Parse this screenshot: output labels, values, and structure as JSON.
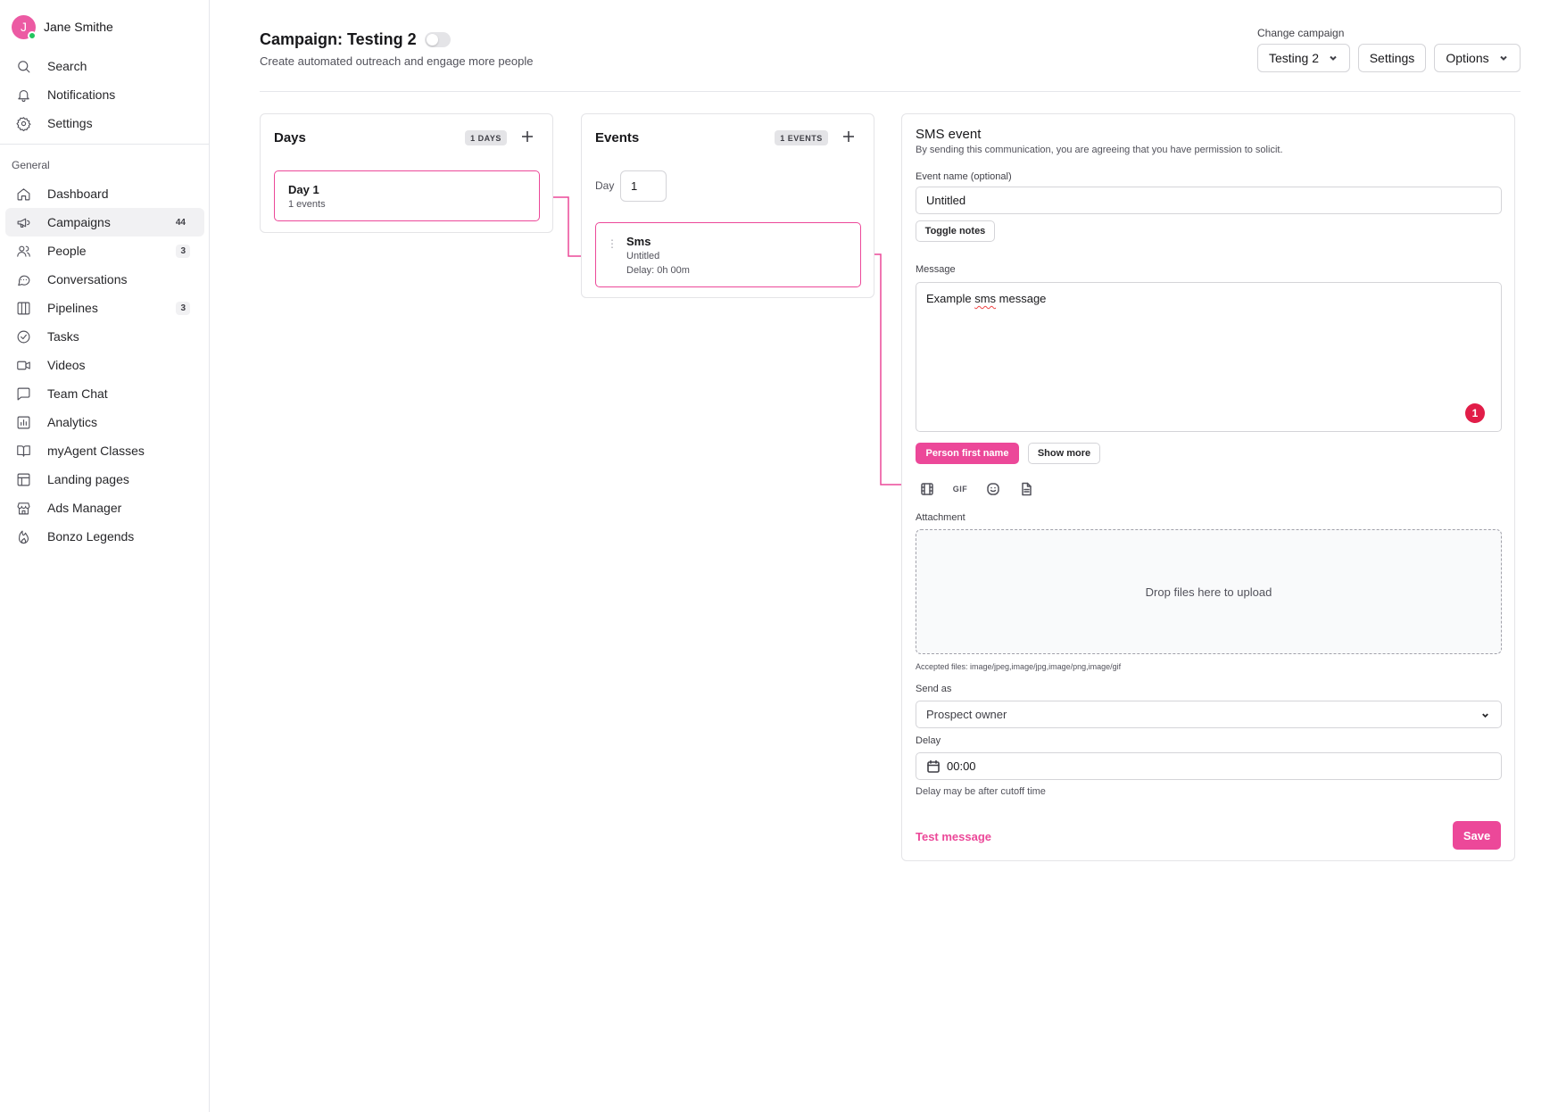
{
  "user": {
    "initial": "J",
    "name": "Jane Smithe"
  },
  "nav_top": [
    {
      "label": "Search",
      "icon": "search-icon"
    },
    {
      "label": "Notifications",
      "icon": "bell-icon"
    },
    {
      "label": "Settings",
      "icon": "gear-icon"
    }
  ],
  "section_title": "General",
  "nav_main": [
    {
      "label": "Dashboard",
      "icon": "home-icon",
      "count": ""
    },
    {
      "label": "Campaigns",
      "icon": "megaphone-icon",
      "count": "44",
      "active": true
    },
    {
      "label": "People",
      "icon": "users-icon",
      "count": "3"
    },
    {
      "label": "Conversations",
      "icon": "chat-bubble-icon",
      "count": ""
    },
    {
      "label": "Pipelines",
      "icon": "columns-icon",
      "count": "3"
    },
    {
      "label": "Tasks",
      "icon": "check-circle-icon",
      "count": ""
    },
    {
      "label": "Videos",
      "icon": "video-icon",
      "count": ""
    },
    {
      "label": "Team Chat",
      "icon": "message-square-icon",
      "count": ""
    },
    {
      "label": "Analytics",
      "icon": "bar-chart-icon",
      "count": ""
    },
    {
      "label": "myAgent Classes",
      "icon": "book-icon",
      "count": ""
    },
    {
      "label": "Landing pages",
      "icon": "layout-icon",
      "count": ""
    },
    {
      "label": "Ads Manager",
      "icon": "store-icon",
      "count": ""
    },
    {
      "label": "Bonzo Legends",
      "icon": "flame-icon",
      "count": ""
    }
  ],
  "header": {
    "title": "Campaign: Testing 2",
    "subtitle": "Create automated outreach and engage more people",
    "change_label": "Change campaign",
    "campaign_select": "Testing 2",
    "settings_label": "Settings",
    "options_label": "Options"
  },
  "days": {
    "title": "Days",
    "pill": "1 DAYS",
    "items": [
      {
        "title": "Day 1",
        "sub": "1 events"
      }
    ]
  },
  "events": {
    "title": "Events",
    "pill": "1 EVENTS",
    "day_label": "Day",
    "day_value": "1",
    "items": [
      {
        "title": "Sms",
        "name": "Untitled",
        "delay": "Delay: 0h 00m"
      }
    ]
  },
  "sms": {
    "title": "SMS event",
    "subtitle": "By sending this communication, you are agreeing that you have permission to solicit.",
    "event_name_label": "Event name (optional)",
    "event_name_value": "Untitled",
    "toggle_notes": "Toggle notes",
    "message_label": "Message",
    "message_before": "Example ",
    "message_spell": "sms",
    "message_after": " message",
    "message_badge": "1",
    "person_first_name": "Person first name",
    "show_more": "Show more",
    "toolbar": [
      "film-icon",
      "gif-icon",
      "emoji-icon",
      "document-icon"
    ],
    "gif_text": "GIF",
    "attachment_label": "Attachment",
    "dropzone_text": "Drop files here to upload",
    "accepted_files": "Accepted files: image/jpeg,image/jpg,image/png,image/gif",
    "send_as_label": "Send as",
    "send_as_value": "Prospect owner",
    "delay_label": "Delay",
    "delay_value": "00:00",
    "delay_hint": "Delay may be after cutoff time",
    "test_message": "Test message",
    "save": "Save"
  },
  "colors": {
    "accent": "#ec4899",
    "badge_red": "#e11d48",
    "online": "#22c55e"
  }
}
